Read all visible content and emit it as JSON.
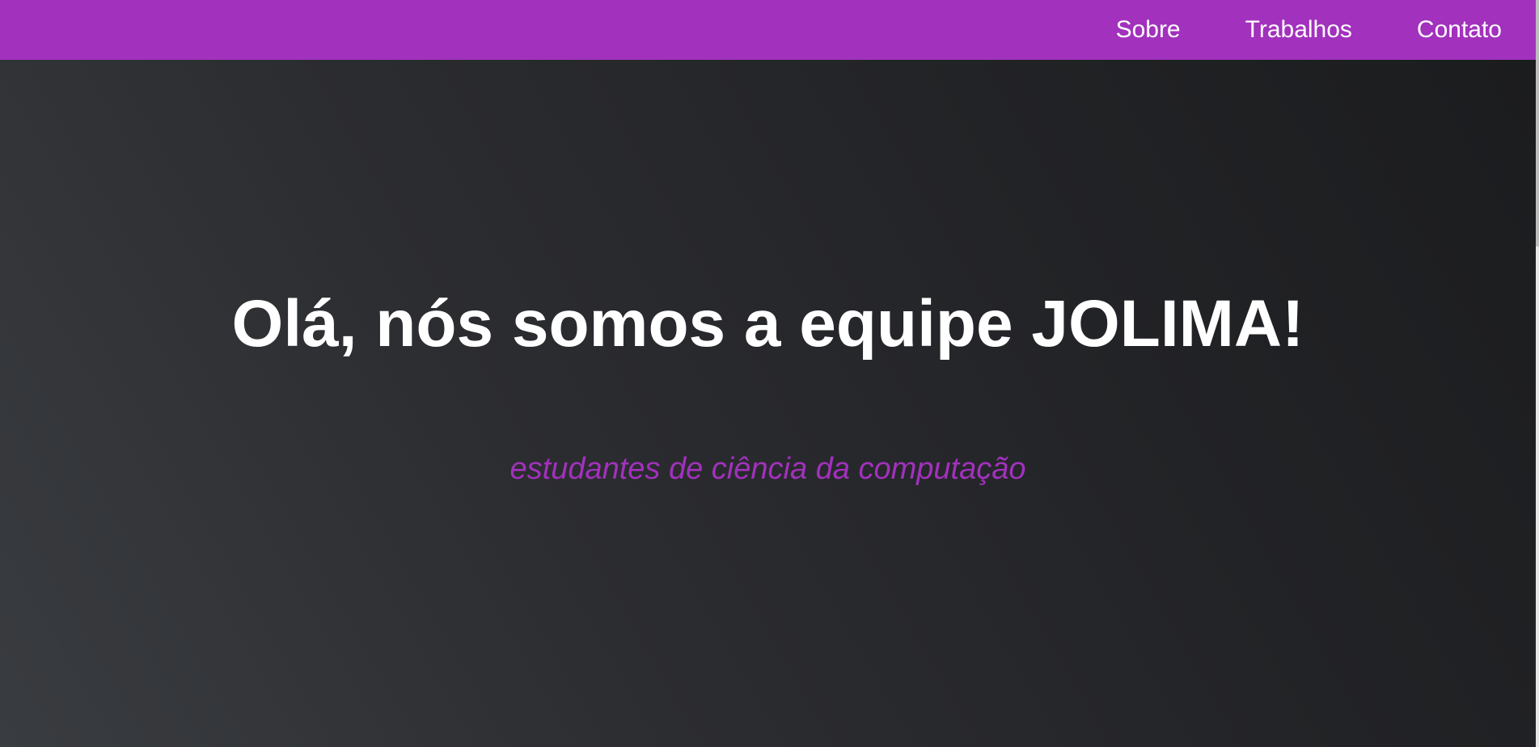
{
  "nav": {
    "links": [
      {
        "label": "Sobre"
      },
      {
        "label": "Trabalhos"
      },
      {
        "label": "Contato"
      }
    ]
  },
  "hero": {
    "title": "Olá, nós somos a equipe JOLIMA!",
    "subtitle": "estudantes de ciência da computação"
  },
  "colors": {
    "accent": "#a231bd",
    "background_dark": "#1b1c1e",
    "text": "#ffffff"
  }
}
